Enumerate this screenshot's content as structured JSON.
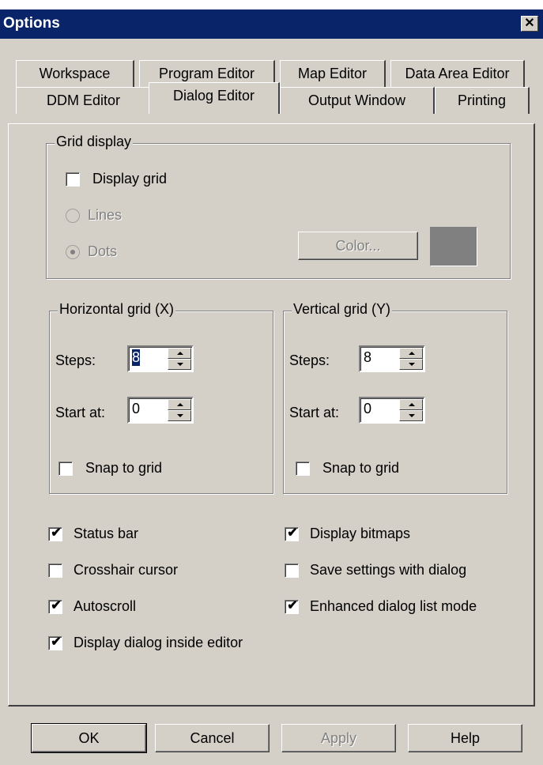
{
  "window": {
    "title": "Options",
    "close_glyph": "✕"
  },
  "tabs": {
    "row1": [
      "Workspace",
      "Program Editor",
      "Map Editor",
      "Data Area Editor"
    ],
    "row2": [
      "DDM Editor",
      "Dialog Editor",
      "Output Window",
      "Printing"
    ],
    "active": "Dialog Editor"
  },
  "grid_display": {
    "legend": "Grid display",
    "display_grid": {
      "label": "Display grid",
      "checked": false
    },
    "lines": {
      "label": "Lines",
      "selected": false,
      "enabled": false
    },
    "dots": {
      "label": "Dots",
      "selected": true,
      "enabled": false
    },
    "color_button": "Color...",
    "color_swatch": "#808080"
  },
  "horizontal_grid": {
    "legend": "Horizontal grid (X)",
    "steps_label": "Steps:",
    "steps_value": "8",
    "start_label": "Start at:",
    "start_value": "0",
    "snap": {
      "label": "Snap to grid",
      "checked": false
    }
  },
  "vertical_grid": {
    "legend": "Vertical grid (Y)",
    "steps_label": "Steps:",
    "steps_value": "8",
    "start_label": "Start at:",
    "start_value": "0",
    "snap": {
      "label": "Snap to grid",
      "checked": false
    }
  },
  "options": {
    "status_bar": {
      "label": "Status bar",
      "checked": true
    },
    "crosshair": {
      "label": "Crosshair cursor",
      "checked": false
    },
    "autoscroll": {
      "label": "Autoscroll",
      "checked": true
    },
    "inside_editor": {
      "label": "Display dialog inside editor",
      "checked": true
    },
    "bitmaps": {
      "label": "Display bitmaps",
      "checked": true
    },
    "save_settings": {
      "label": "Save settings with dialog",
      "checked": false
    },
    "enhanced_list": {
      "label": "Enhanced dialog list mode",
      "checked": true
    }
  },
  "buttons": {
    "ok": "OK",
    "cancel": "Cancel",
    "apply": "Apply",
    "help": "Help"
  },
  "check_glyph": "✔"
}
